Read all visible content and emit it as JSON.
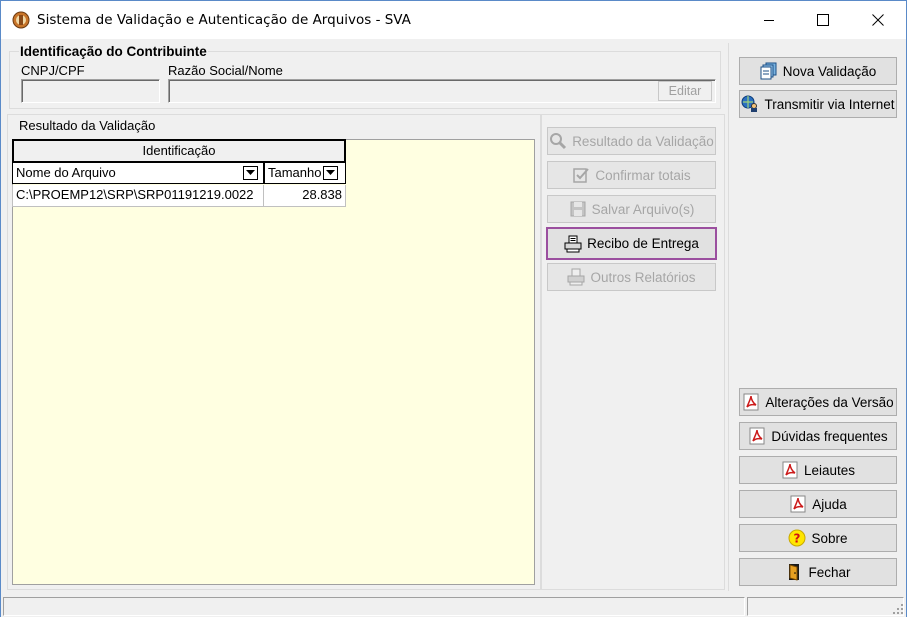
{
  "window": {
    "title": "Sistema de Validação e Autenticação de Arquivos - SVA",
    "icon": "sva-app-icon"
  },
  "contributor": {
    "group_title": "Identificação do Contribuinte",
    "cnpj_label": "CNPJ/CPF",
    "cnpj_value": "",
    "name_label": "Razão Social/Nome",
    "name_value": "",
    "edit_label": "Editar"
  },
  "result": {
    "group_title": "Resultado da Validação",
    "grid_header": "Identificação",
    "columns": [
      "Nome do Arquivo",
      "Tamanho"
    ],
    "rows": [
      {
        "file": "C:\\PROEMP12\\SRP\\SRP01191219.0022",
        "size": "28.838"
      }
    ]
  },
  "actions": {
    "resultado": "Resultado da Validação",
    "confirmar": "Confirmar totais",
    "salvar": "Salvar Arquivo(s)",
    "recibo": "Recibo de Entrega",
    "outros": "Outros Relatórios"
  },
  "side": {
    "nova": "Nova Validação",
    "transmitir": "Transmitir via Internet",
    "alteracoes": "Alterações da Versão",
    "duvidas": "Dúvidas frequentes",
    "leiautes": "Leiautes",
    "ajuda": "Ajuda",
    "sobre": "Sobre",
    "fechar": "Fechar"
  },
  "colors": {
    "result_background": "#ffffe1",
    "focus_border": "#9b4f9f",
    "pdf_red": "#cc1b1b"
  }
}
